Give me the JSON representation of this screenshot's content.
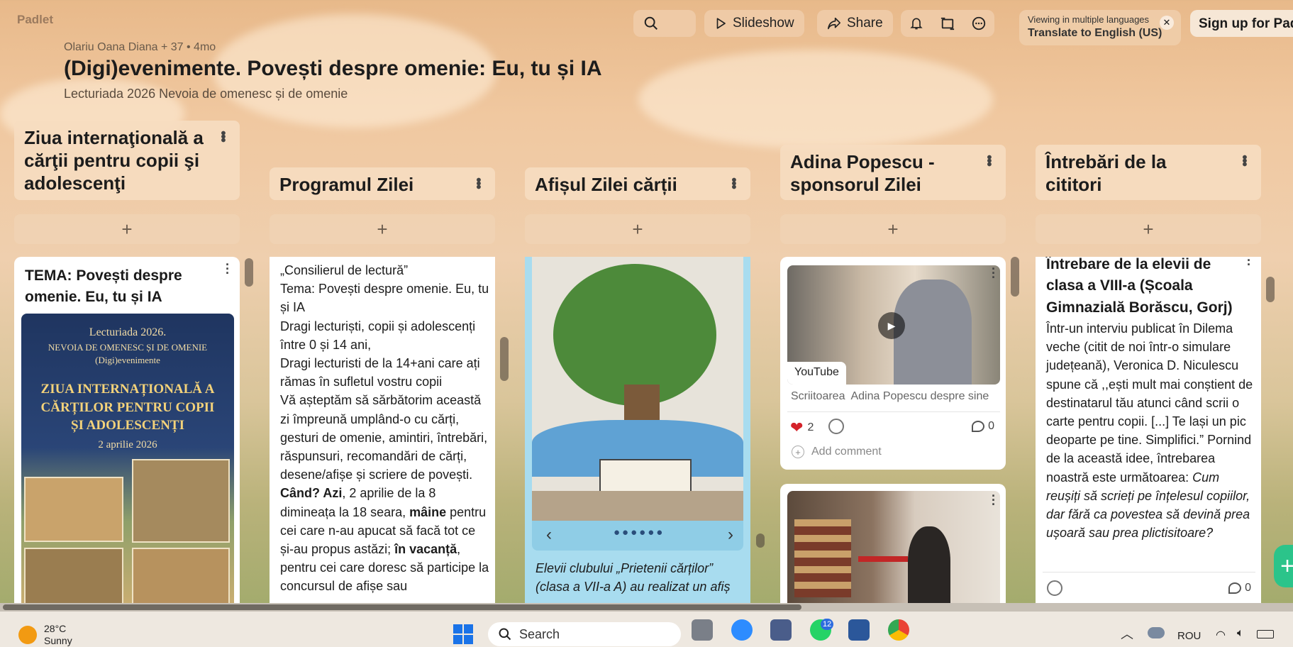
{
  "app": {
    "logo": "Padlet"
  },
  "toolbar": {
    "search_icon": "search-icon",
    "slideshow_label": "Slideshow",
    "share_label": "Share",
    "bell_icon": "bell-icon",
    "remake_icon": "remake-icon",
    "more_icon": "more-icon",
    "lang_line1": "Viewing in multiple languages",
    "lang_line2": "Translate to English (US)",
    "signup_label": "Sign up for Padlet"
  },
  "board": {
    "meta": "Olariu Oana Diana + 37 • 4mo",
    "title": "(Digi)evenimente. Povești despre omenie: Eu, tu și IA",
    "subtitle": "Lecturiada 2026 Nevoia de omenesc și de omenie"
  },
  "columns": [
    {
      "title": "Ziua internaţională a cărţii pentru copii şi adolescenţi"
    },
    {
      "title": "Programul Zilei"
    },
    {
      "title": "Afișul Zilei cărții"
    },
    {
      "title": "Adina Popescu - sponsorul Zilei"
    },
    {
      "title": "Întrebări de la cititori"
    }
  ],
  "add_symbol": "+",
  "cards": {
    "c1": {
      "title": "TEMA: Povești despre omenie. Eu, tu și IA",
      "poster": {
        "line1": "Lecturiada 2026.",
        "line2": "NEVOIA DE OMENESC ȘI DE OMENIE",
        "line3": "(Digi)evenimente",
        "big": "ZIUA INTERNAȚIONALĂ A CĂRȚILOR PENTRU COPII ȘI ADOLESCENȚI",
        "date": "2 aprilie 2026"
      }
    },
    "c2": {
      "p1": "„Consilierul de lectură”",
      "p2": "Tema: Povești despre omenie. Eu, tu și IA",
      "p3": "Dragi lecturiști, copii și adolescenți între 0 și 14 ani,",
      "p4": "Dragi lecturisti de la 14+ani care ați rămas în sufletul vostru copii",
      "p5": "Vă așteptăm să sărbătorim această zi împreună umplând-o cu cărți, gesturi de omenie, amintiri, întrebări, răspunsuri, recomandări de cărți, desene/afișe și scriere de povești.",
      "p6a": "Când? Azi",
      "p6b": ", 2 aprilie de la 8 dimineața la 18 seara, ",
      "p6c": "mâine",
      "p6d": " pentru cei care n-au apucat să facă tot ce și-au propus astăzi; ",
      "p6e": "în vacanță",
      "p6f": ", pentru cei care doresc să participe la concursul de afișe sau"
    },
    "c3": {
      "caption": "Elevii clubului „Prietenii cărților” (clasa a VII-a A) au realizat un afiș ..."
    },
    "c4": {
      "badge": "YouTube",
      "meta": "Scriitoarea  Adina Popescu despre sine",
      "likes": "2",
      "comments": "0",
      "add_comment": "Add comment"
    },
    "c6": {
      "title": "Întrebare de la elevii de clasa a VIII-a (Școala Gimnazială Borăscu, Gorj)",
      "body": "Într-un interviu publicat în Dilema veche (citit de noi într-o simulare județeană), Veronica D. Niculescu spune că ,,ești mult mai conștient de destinatarul tău atunci când scrii o carte pentru copii. [...] Te lași un pic deoparte pe tine. Simplifici.” Pornind de la această idee, întrebarea noastră este următoarea: ",
      "question": "Cum reușiți să scrieți pe înțelesul copiilor, dar fără ca povestea să devină prea ușoară sau prea plictisitoare?",
      "comments": "0"
    }
  },
  "taskbar": {
    "temp": "28°C",
    "weather": "Sunny",
    "search_placeholder": "Search",
    "whatsapp_badge": "12",
    "lang": "ROU"
  }
}
